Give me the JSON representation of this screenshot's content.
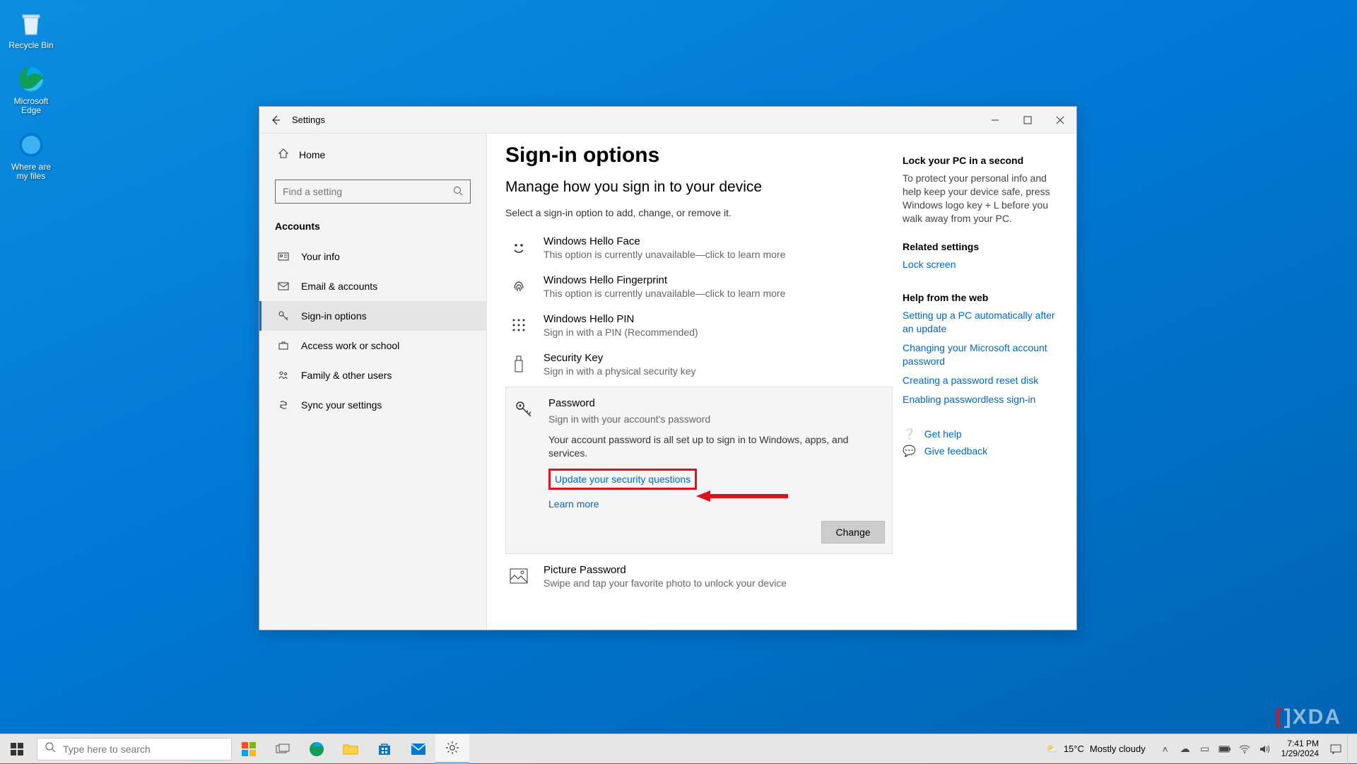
{
  "desktop": {
    "icons": [
      {
        "name": "recycle-bin",
        "label": "Recycle Bin"
      },
      {
        "name": "edge",
        "label": "Microsoft Edge"
      },
      {
        "name": "where-files",
        "label": "Where are my files"
      }
    ]
  },
  "window": {
    "title": "Settings",
    "page_title": "Sign-in options",
    "subtitle": "Manage how you sign in to your device",
    "helper": "Select a sign-in option to add, change, or remove it.",
    "home_label": "Home",
    "search_placeholder": "Find a setting",
    "category": "Accounts"
  },
  "nav": [
    {
      "id": "your-info",
      "label": "Your info"
    },
    {
      "id": "email",
      "label": "Email & accounts"
    },
    {
      "id": "signin",
      "label": "Sign-in options",
      "active": true
    },
    {
      "id": "work",
      "label": "Access work or school"
    },
    {
      "id": "family",
      "label": "Family & other users"
    },
    {
      "id": "sync",
      "label": "Sync your settings"
    }
  ],
  "options": {
    "face": {
      "title": "Windows Hello Face",
      "sub": "This option is currently unavailable—click to learn more"
    },
    "finger": {
      "title": "Windows Hello Fingerprint",
      "sub": "This option is currently unavailable—click to learn more"
    },
    "pin": {
      "title": "Windows Hello PIN",
      "sub": "Sign in with a PIN (Recommended)"
    },
    "seckey": {
      "title": "Security Key",
      "sub": "Sign in with a physical security key"
    },
    "password": {
      "title": "Password",
      "sub": "Sign in with your account's password",
      "desc": "Your account password is all set up to sign in to Windows, apps, and services.",
      "update_link": "Update your security questions",
      "learn_link": "Learn more",
      "change_btn": "Change"
    },
    "picture": {
      "title": "Picture Password",
      "sub": "Swipe and tap your favorite photo to unlock your device"
    }
  },
  "right": {
    "lock_title": "Lock your PC in a second",
    "lock_body": "To protect your personal info and help keep your device safe, press Windows logo key + L before you walk away from your PC.",
    "related_title": "Related settings",
    "related_link": "Lock screen",
    "webhelp_title": "Help from the web",
    "web_links": [
      "Setting up a PC automatically after an update",
      "Changing your Microsoft account password",
      "Creating a password reset disk",
      "Enabling passwordless sign-in"
    ],
    "get_help": "Get help",
    "feedback": "Give feedback"
  },
  "taskbar": {
    "search_placeholder": "Type here to search",
    "weather_temp": "15°C",
    "weather_cond": "Mostly cloudy",
    "time": "7:41 PM",
    "date": "1/29/2024"
  }
}
